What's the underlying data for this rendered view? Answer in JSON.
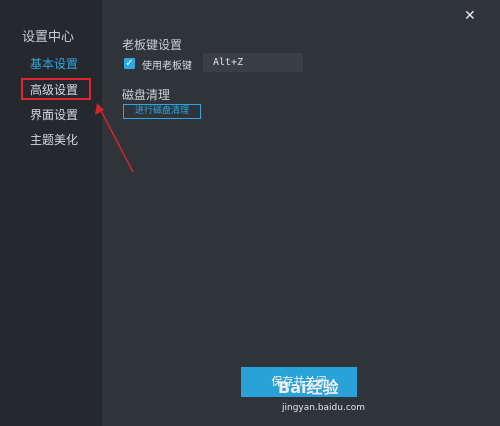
{
  "sidebar": {
    "title": "设置中心",
    "items": [
      {
        "label": "基本设置"
      },
      {
        "label": "高级设置"
      },
      {
        "label": "界面设置"
      },
      {
        "label": "主题美化"
      }
    ]
  },
  "main": {
    "close_icon": "close-icon",
    "bosskey": {
      "section_title": "老板键设置",
      "checkbox_label": "使用老板键",
      "checked": true,
      "hotkey_value": "Alt+Z"
    },
    "disk": {
      "section_title": "磁盘清理",
      "clean_button": "进行磁盘清理"
    },
    "save_button": "保存并关闭"
  },
  "watermark": {
    "brand": "Bai经验",
    "url": "jingyan.baidu.com"
  },
  "colors": {
    "accent": "#2ea7e0",
    "highlight_red": "#e0242d",
    "bg": "#2f343a",
    "sidebar_bg": "#25292e"
  }
}
